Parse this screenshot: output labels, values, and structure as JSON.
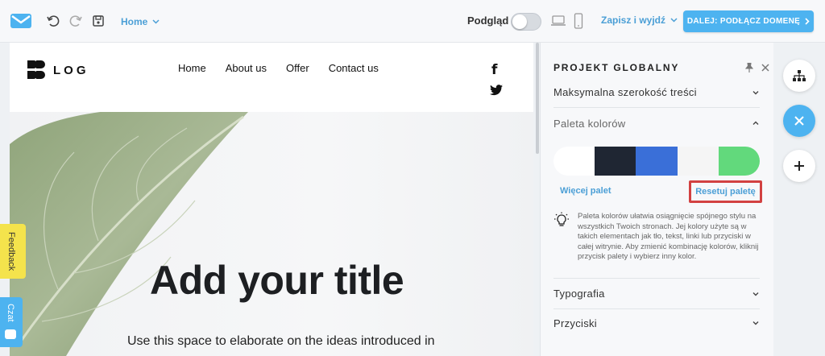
{
  "toolbar": {
    "page_select": "Home",
    "preview_label": "Podgląd",
    "save_exit": "Zapisz i wyjdź",
    "next_button": "DALEJ: PODŁĄCZ DOMENĘ"
  },
  "site": {
    "logo_text": "LOG",
    "nav": [
      "Home",
      "About us",
      "Offer",
      "Contact us"
    ],
    "facebook_glyph": "f",
    "hero_title": "Add your title",
    "hero_text": "Use this space to elaborate on the ideas introduced in"
  },
  "side_tabs": {
    "feedback": "Feedback",
    "chat": "Czat"
  },
  "panel": {
    "title": "PROJEKT GLOBALNY",
    "sections": {
      "max_width": "Maksymalna szerokość treści",
      "palette": "Paleta kolorów",
      "typography": "Typografia",
      "buttons": "Przyciski"
    },
    "palette_colors": [
      "#ffffff",
      "#1f2633",
      "#3a6fd8",
      "#f5f5f5",
      "#62d97c"
    ],
    "more_palettes": "Więcej palet",
    "reset_palette": "Resetuj paletę",
    "hint": "Paleta kolorów ułatwia osiągnięcie spójnego stylu na wszystkich Twoich stronach. Jej kolory użyte są w takich elementach jak tło, tekst, linki lub przyciski w całej witrynie. Aby zmienić kombinację kolorów, kliknij przycisk palety i wybierz inny kolor."
  },
  "colors": {
    "accent": "#4db3f0",
    "link": "#4b9fd6",
    "highlight": "#d24141",
    "feedback_tab": "#f4e34c"
  }
}
